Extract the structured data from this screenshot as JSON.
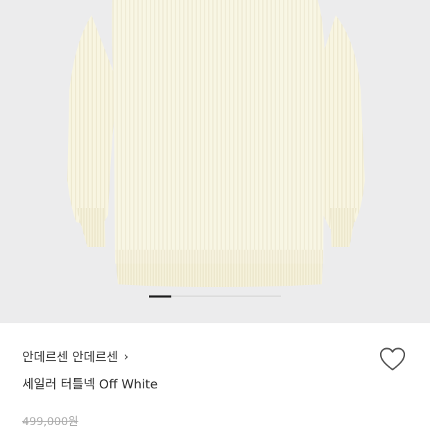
{
  "product": {
    "brand": "안데르센 안데르센",
    "name": "세일러 터틀넥 Off White",
    "original_price": "499,000원",
    "image_icon": "sweater-image",
    "sweater_color": "#f8f5e1"
  },
  "gallery": {
    "background": "#ececed"
  },
  "icons": {
    "brand_chevron": "›",
    "like": "heart-outline-icon"
  }
}
